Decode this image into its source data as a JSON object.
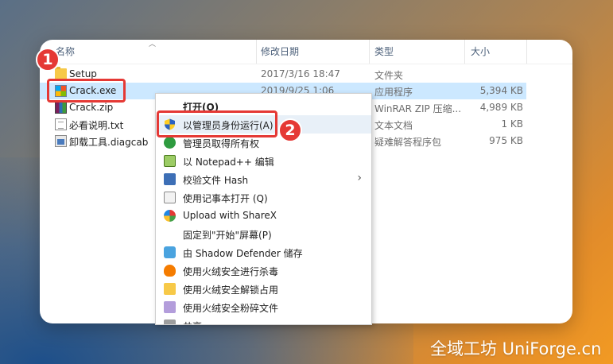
{
  "columns": {
    "name": "名称",
    "modified": "修改日期",
    "type": "类型",
    "size": "大小"
  },
  "files": [
    {
      "name": "Setup",
      "modified": "2017/3/16 18:47",
      "type": "文件夹",
      "size": "",
      "icon": "folder-icon"
    },
    {
      "name": "Crack.exe",
      "modified": "2019/9/25 1:06",
      "type": "应用程序",
      "size": "5,394 KB",
      "icon": "exe-icon",
      "selected": true
    },
    {
      "name": "Crack.zip",
      "modified": "",
      "type": "WinRAR ZIP 压缩...",
      "size": "4,989 KB",
      "icon": "winrar-icon"
    },
    {
      "name": "必看说明.txt",
      "modified": "",
      "type": "文本文档",
      "size": "1 KB",
      "icon": "text-file-icon"
    },
    {
      "name": "卸载工具.diagcab",
      "modified": "",
      "type": "疑难解答程序包",
      "size": "975 KB",
      "icon": "diagcab-icon"
    }
  ],
  "context_menu": {
    "items": [
      {
        "label": "打开(O)",
        "bold": true
      },
      {
        "label": "以管理员身份运行(A)",
        "icon": "uac-shield-icon"
      },
      {
        "label": "管理员取得所有权",
        "icon": "green-shield-icon"
      },
      {
        "label": "以 Notepad++ 编辑",
        "icon": "notepadpp-icon"
      },
      {
        "label": "校验文件 Hash",
        "icon": "hash-icon",
        "submenu": true
      },
      {
        "label": "使用记事本打开 (Q)",
        "icon": "notepad-icon"
      },
      {
        "label": "Upload with ShareX",
        "icon": "sharex-icon"
      },
      {
        "label": "固定到\"开始\"屏幕(P)"
      },
      {
        "label": "由 Shadow Defender 储存",
        "icon": "shadow-defender-icon"
      },
      {
        "label": "使用火绒安全进行杀毒",
        "icon": "huorong-icon"
      },
      {
        "label": "使用火绒安全解锁占用",
        "icon": "folder-lock-icon"
      },
      {
        "label": "使用火绒安全粉碎文件",
        "icon": "shred-icon"
      },
      {
        "label": "共享",
        "icon": "share-icon"
      }
    ]
  },
  "annotations": {
    "step1": "1",
    "step2": "2"
  },
  "watermark": "全域工坊 UniForge.cn",
  "colors": {
    "highlight": "#e53935",
    "selection": "#cce8ff",
    "header_text": "#4c607a"
  }
}
